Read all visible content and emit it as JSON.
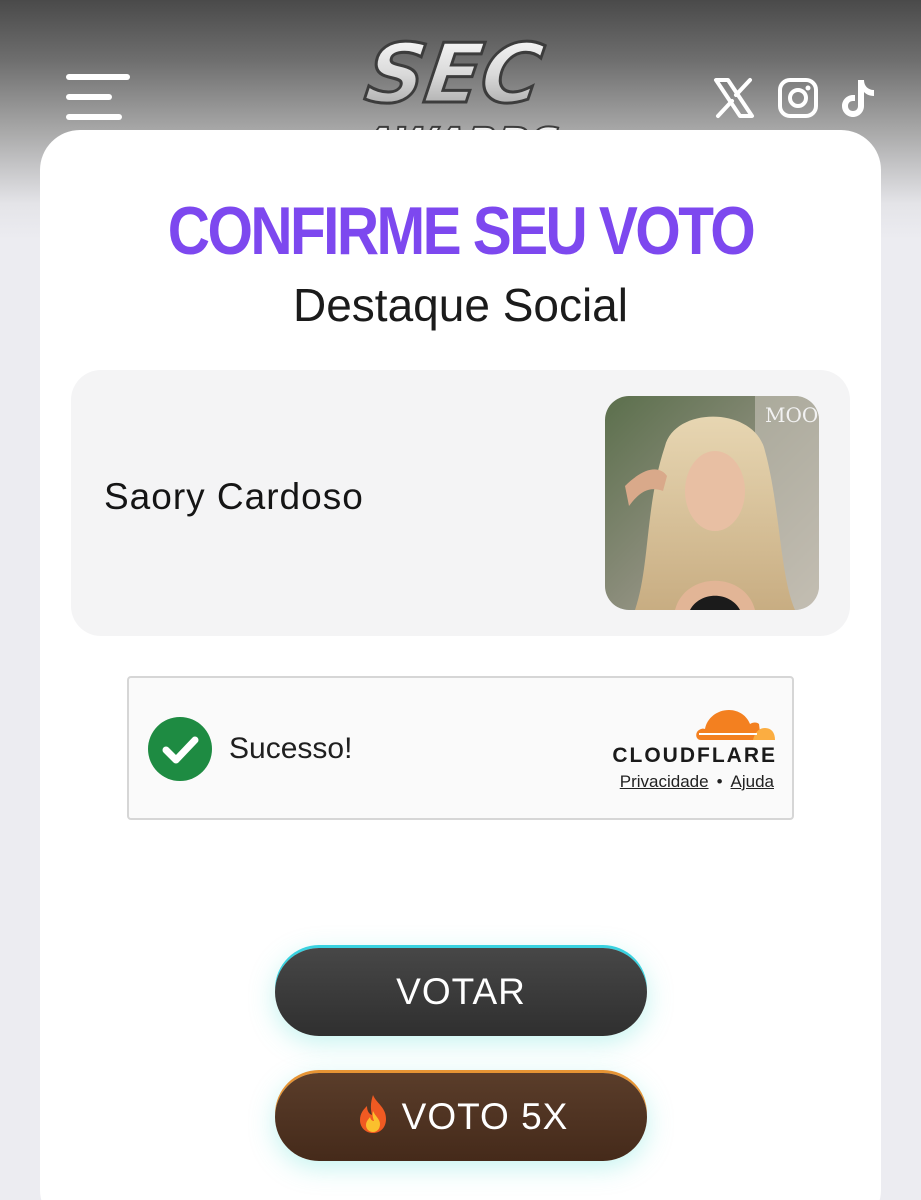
{
  "header": {
    "logo_text_top": "SEC",
    "logo_text_bottom": "AWARDS",
    "social_icons": [
      "x-icon",
      "instagram-icon",
      "tiktok-icon"
    ]
  },
  "page": {
    "title": "CONFIRME SEU VOTO",
    "category": "Destaque Social"
  },
  "nominee": {
    "name": "Saory Cardoso",
    "photo_overlay_text": "MOOD"
  },
  "captcha": {
    "status": "Sucesso!",
    "provider": "CLOUDFLARE",
    "privacy_link": "Privacidade",
    "separator": "•",
    "help_link": "Ajuda"
  },
  "buttons": {
    "vote_label": "VOTAR",
    "vote5_label": "VOTO 5X"
  },
  "colors": {
    "title_purple": "#7d48ef",
    "success_green": "#1e8b42",
    "cloudflare_orange": "#f38020",
    "vote_button": "#3a3a3a",
    "vote5_button": "#4f3322"
  }
}
